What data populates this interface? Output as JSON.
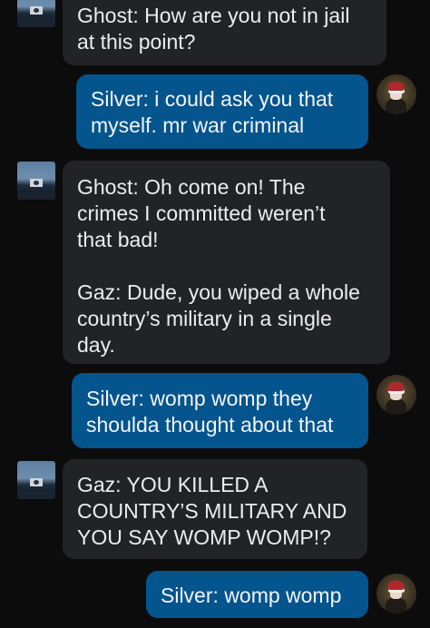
{
  "chat": {
    "messages": [
      {
        "sender": "ghost",
        "direction": "incoming",
        "avatar": "ghost-avatar",
        "lines": [
          "Ghost: How are you not in jail",
          "at this point?"
        ]
      },
      {
        "sender": "silver",
        "direction": "outgoing",
        "avatar": "silver-avatar",
        "lines": [
          "Silver: i could ask you that",
          "myself. mr war criminal"
        ]
      },
      {
        "sender": "ghost",
        "direction": "incoming",
        "avatar": "ghost-avatar",
        "lines": [
          "Ghost: Oh come on! The",
          "crimes I committed weren’t",
          "that bad!",
          "Gaz: Dude, you wiped a whole",
          "country’s military in a single",
          "day."
        ]
      },
      {
        "sender": "silver",
        "direction": "outgoing",
        "avatar": "silver-avatar",
        "lines": [
          "Silver: womp womp they",
          "shoulda thought about that"
        ]
      },
      {
        "sender": "ghost",
        "direction": "incoming",
        "avatar": "ghost-avatar",
        "lines": [
          "Gaz: YOU KILLED A",
          "COUNTRY’S MILITARY AND",
          "YOU SAY WOMP WOMP!?"
        ]
      },
      {
        "sender": "silver",
        "direction": "outgoing",
        "avatar": "silver-avatar",
        "lines": [
          "Silver: womp womp"
        ]
      }
    ]
  },
  "colors": {
    "background": "#0c0c0d",
    "incoming_bubble": "#222326",
    "outgoing_bubble": "#04548d",
    "text": "#ebedf0"
  }
}
